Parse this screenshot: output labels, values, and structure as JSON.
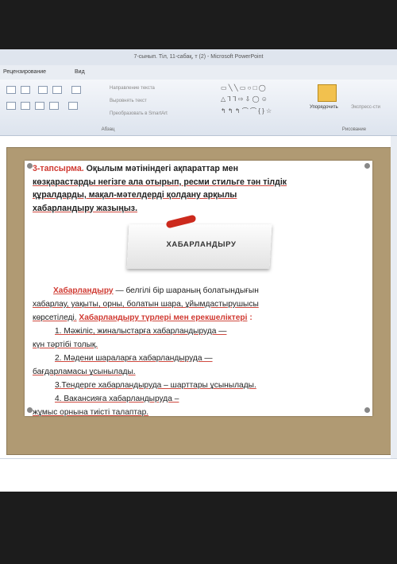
{
  "window": {
    "title": "7-сынып. Тіл, 11-сабақ, т (2) - Microsoft PowerPoint"
  },
  "menu": {
    "review": "Рецензирование",
    "view": "Вид"
  },
  "ribbon": {
    "text_direction": "Направление текста",
    "align_text": "Выровнять текст",
    "convert_smartart": "Преобразовать в SmartArt",
    "paragraph_label": "Абзац",
    "arrange_label": "Упорядочить",
    "quick_styles_label": "Экспресс-сти",
    "drawing_label": "Рисование"
  },
  "slide": {
    "task_label": "3-тапсырма.",
    "task_text_1": "Оқылым мәтініндегі ақпараттар мен",
    "task_text_2": "көзқарастарды негізге ала отырып, ресми стильге тән тілдік",
    "task_text_3": "құралдарды, мақал-мәтелдерді қолдану арқылы",
    "task_text_4": "хабарландыру жазыңыз.",
    "note_title": "ХАБАРЛАНДЫРУ",
    "para_term": "Хабарландыру",
    "para_1": " — белгілі бір шараның болатындығын",
    "para_2": "хабарлау, уақыты, орны, болатын шара, ұйымдастырушысы",
    "para_3a": "көрсетіледі.",
    "para_3b": "Хабарландыру түрлері мен ерекшеліктері",
    "para_3c": ":",
    "item1a": "1. Мәжіліс, жиналыстарға хабарландыруда —",
    "item1b": "күн тәртібі толық.",
    "item2a": "2. Мәдени шараларға хабарландыруда —",
    "item2b": "бағдарламасы ұсынылады.",
    "item3": "3.Тендерге хабарландыруда – шарттары ұсынылады.",
    "item4a": "4. Вакансияға хабарландыруда –",
    "item4b": "жұмыс орнына тиісті талаптар."
  }
}
